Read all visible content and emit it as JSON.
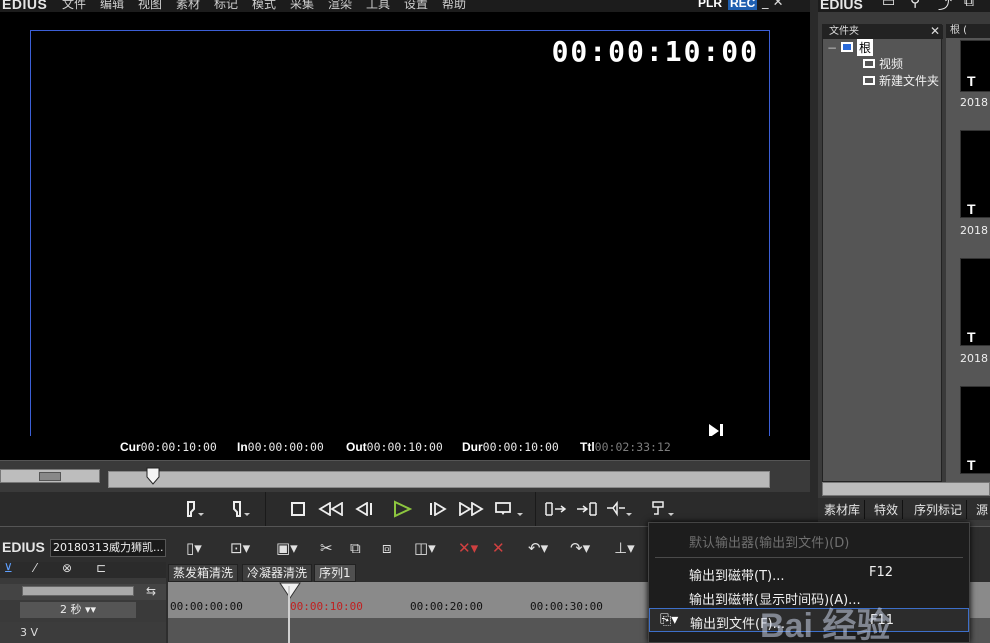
{
  "app": {
    "brand": "EDIUS",
    "menu": [
      "文件",
      "编辑",
      "视图",
      "素材",
      "标记",
      "模式",
      "采集",
      "渲染",
      "工具",
      "设置",
      "帮助"
    ],
    "plr": "PLR",
    "rec": "REC",
    "window_controls": "_ ✕"
  },
  "player": {
    "timecode": "00:00:10:00",
    "status": {
      "cur_label": "Cur",
      "cur": "00:00:10:00",
      "in_label": "In",
      "in": "00:00:00:00",
      "out_label": "Out",
      "out": "00:00:10:00",
      "dur_label": "Dur",
      "dur": "00:00:10:00",
      "ttl_label": "Ttl",
      "ttl": "00:02:33:12"
    }
  },
  "bin": {
    "brand": "EDIUS",
    "folder_title": "文件夹",
    "tree": [
      "根",
      "视频",
      "新建文件夹"
    ],
    "clips_title": "根 (",
    "clip_dates": [
      "2018",
      "2018",
      "2018",
      "2018"
    ],
    "clip_letter": "T",
    "tabs": [
      "素材库",
      "特效",
      "序列标记",
      "源"
    ]
  },
  "timeline": {
    "brand": "EDIUS",
    "project": "20180313威力狮凯...",
    "sequence_tabs": [
      "蒸发箱清洗",
      "冷凝器清洗",
      "序列1"
    ],
    "scale": "2 秒",
    "track": "3 V",
    "ruler": [
      "00:00:00:00",
      "00:00:10:00",
      "00:00:20:00",
      "00:00:30:00"
    ]
  },
  "menu": {
    "items": [
      {
        "label": "默认输出器(输出到文件)(D)",
        "key": "",
        "disabled": true
      },
      {
        "label": "输出到磁带(T)...",
        "key": "F12",
        "disabled": false
      },
      {
        "label": "输出到磁带(显示时间码)(A)...",
        "key": "",
        "disabled": false
      },
      {
        "label": "输出到文件(F)...",
        "key": "F11",
        "disabled": false,
        "highlighted": true
      }
    ]
  },
  "watermark": "Bai 经验"
}
